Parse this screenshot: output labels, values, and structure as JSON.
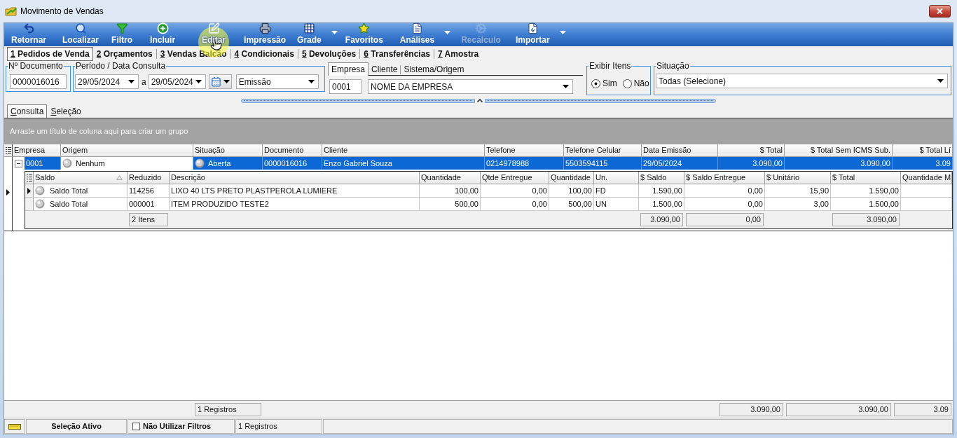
{
  "window": {
    "title": "Movimento de Vendas"
  },
  "toolbar": [
    {
      "label": "Retornar",
      "kind": "return",
      "menu": false,
      "disabled": false,
      "pointer": false
    },
    {
      "label": "Localizar",
      "kind": "search",
      "menu": false,
      "disabled": false,
      "pointer": false
    },
    {
      "label": "Filtro",
      "kind": "filter",
      "menu": false,
      "disabled": false,
      "pointer": false
    },
    {
      "label": "Incluir",
      "kind": "add",
      "menu": false,
      "disabled": false,
      "pointer": false
    },
    {
      "label": "Editar",
      "kind": "edit",
      "menu": false,
      "disabled": false,
      "pointer": true
    },
    {
      "label": "Impressão",
      "kind": "print",
      "menu": false,
      "disabled": false,
      "pointer": false
    },
    {
      "label": "Grade",
      "kind": "grid",
      "menu": true,
      "disabled": false,
      "pointer": false
    },
    {
      "label": "Favoritos",
      "kind": "favorites",
      "menu": false,
      "disabled": false,
      "pointer": false
    },
    {
      "label": "Análises",
      "kind": "report",
      "menu": true,
      "disabled": false,
      "pointer": false
    },
    {
      "label": "Recálculo",
      "kind": "recalc",
      "menu": false,
      "disabled": true,
      "pointer": false
    },
    {
      "label": "Importar",
      "kind": "import",
      "menu": true,
      "disabled": false,
      "pointer": false
    }
  ],
  "tabs": [
    {
      "label": "1 Pedidos de Venda",
      "selected": true
    },
    {
      "label": "2 Orçamentos",
      "selected": false
    },
    {
      "label": "3 Vendas Balcão",
      "selected": false
    },
    {
      "label": "4 Condicionais",
      "selected": false
    },
    {
      "label": "5 Devoluções",
      "selected": false
    },
    {
      "label": "6 Transferências",
      "selected": false
    },
    {
      "label": "7 Amostra",
      "selected": false
    }
  ],
  "filters": {
    "document": {
      "label": "Nº Documento",
      "value": "0000016016"
    },
    "period": {
      "label": "Período / Data Consulta",
      "from": "29/05/2024",
      "separator": "a",
      "to": "29/05/2024",
      "date_type": "Emissão"
    },
    "company_tabs": [
      {
        "label": "Empresa",
        "selected": true
      },
      {
        "label": "Cliente",
        "selected": false
      },
      {
        "label": "Sistema/Origem",
        "selected": false
      }
    ],
    "company": {
      "code": "0001",
      "name": "NOME DA EMPRESA"
    },
    "show_items": {
      "label": "Exibir Itens",
      "options": [
        {
          "label": "Sim",
          "selected": true
        },
        {
          "label": "Não",
          "selected": false
        }
      ]
    },
    "status": {
      "label": "Situação",
      "value": "Todas (Selecione)"
    }
  },
  "view_tabs": [
    {
      "label": "Consulta",
      "selected": true
    },
    {
      "label": "Seleção",
      "selected": false
    }
  ],
  "group_panel": {
    "hint": "Arraste um título de coluna aqui para criar um grupo"
  },
  "grid": {
    "columns": [
      {
        "label": "Empresa",
        "kind": "text"
      },
      {
        "label": "Origem",
        "kind": "status"
      },
      {
        "label": "Situação",
        "kind": "status",
        "total": "1 Registros"
      },
      {
        "label": "Documento",
        "kind": "text"
      },
      {
        "label": "Cliente",
        "kind": "text"
      },
      {
        "label": "Telefone",
        "kind": "text"
      },
      {
        "label": "Telefone Celular",
        "kind": "text"
      },
      {
        "label": "Data Emissão",
        "kind": "text"
      },
      {
        "label": "$ Total",
        "kind": "number",
        "total": "3.090,00"
      },
      {
        "label": "$ Total Sem ICMS Sub.",
        "kind": "number",
        "total": "3.090,00"
      },
      {
        "label": "$ Total Lí",
        "kind": "number",
        "total": "3.09"
      }
    ],
    "rows": [
      {
        "selected": true,
        "expanded": true,
        "current": true,
        "cells": [
          {
            "text": "0001",
            "focused": false
          },
          {
            "text": "Nenhum",
            "focused": true
          },
          {
            "text": "Aberta",
            "focused": false
          },
          {
            "text": "0000016016",
            "focused": false
          },
          {
            "text": "Enzo Gabriel Souza",
            "focused": false
          },
          {
            "text": "0214978988",
            "focused": false
          },
          {
            "text": "5503594115",
            "focused": false
          },
          {
            "text": "29/05/2024",
            "focused": false
          },
          {
            "text": "3.090,00",
            "focused": false
          },
          {
            "text": "3.090,00",
            "focused": false
          },
          {
            "text": "3.09",
            "focused": false
          }
        ],
        "details": {
          "columns": [
            {
              "label": "Saldo",
              "kind": "status",
              "sorted": true
            },
            {
              "label": "Reduzido",
              "kind": "text",
              "sorted": false,
              "total": "2 Itens"
            },
            {
              "label": "Descrição",
              "kind": "text",
              "sorted": false
            },
            {
              "label": "Quantidade",
              "kind": "number",
              "sorted": false
            },
            {
              "label": "Qtde Entregue",
              "kind": "number",
              "sorted": false
            },
            {
              "label": "Quantidade",
              "kind": "number",
              "sorted": false
            },
            {
              "label": "Un.",
              "kind": "text",
              "sorted": false
            },
            {
              "label": "$ Saldo",
              "kind": "number",
              "sorted": false,
              "total": "3.090,00"
            },
            {
              "label": "$ Saldo Entregue",
              "kind": "number",
              "sorted": false,
              "total": "0,00"
            },
            {
              "label": "$ Unitário",
              "kind": "number",
              "sorted": false
            },
            {
              "label": "$ Total",
              "kind": "number",
              "sorted": false,
              "total": "3.090,00"
            },
            {
              "label": "Quantidade M",
              "kind": "number",
              "sorted": false
            }
          ],
          "rows": [
            {
              "current": true,
              "cells": [
                "Saldo Total",
                "114256",
                "LIXO 40 LTS PRETO PLASTPEROLA LUMIERE",
                "100,00",
                "0,00",
                "100,00",
                "FD",
                "1.590,00",
                "0,00",
                "15,90",
                "1.590,00"
              ]
            },
            {
              "current": false,
              "cells": [
                "Saldo Total",
                "000001",
                "ITEM PRODUZIDO TESTE2",
                "500,00",
                "0,00",
                "500,00",
                "UN",
                "1.500,00",
                "0,00",
                "3,00",
                "1.500,00"
              ]
            }
          ]
        }
      }
    ]
  },
  "status_bar": {
    "selection": "Seleção Ativo",
    "no_filters": {
      "label": "Não Utilizar Filtros",
      "checked": false
    },
    "records": "1 Registros"
  }
}
